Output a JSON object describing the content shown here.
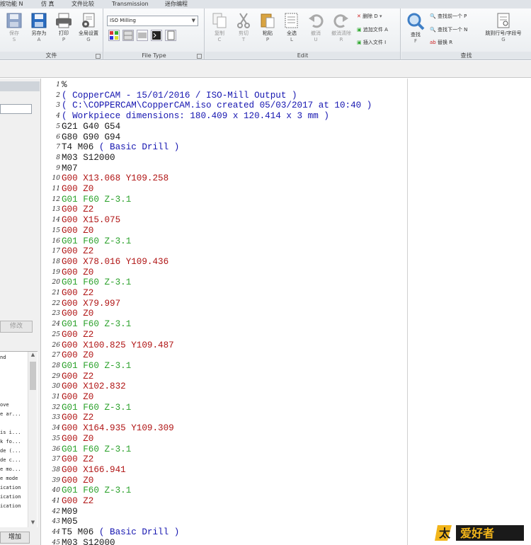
{
  "tabs": [
    "按功能 N",
    "仿 真",
    "文件比较",
    "Transmission",
    "迷你编程"
  ],
  "ribbon": {
    "file": {
      "label": "文件",
      "save": {
        "label": "保存",
        "key": "S"
      },
      "saveas": {
        "label": "另存为",
        "key": "A"
      },
      "print": {
        "label": "打印",
        "key": "P"
      },
      "settings": {
        "label": "全局设置",
        "key": "G"
      }
    },
    "filetype": {
      "label": "File Type",
      "selected": "ISO Milling"
    },
    "edit": {
      "label": "Edit",
      "copy": {
        "label": "复制",
        "key": "C"
      },
      "cut": {
        "label": "剪切",
        "key": "T"
      },
      "paste": {
        "label": "粘贴",
        "key": "P"
      },
      "selectall": {
        "label": "全选",
        "key": "L"
      },
      "undo": {
        "label": "撤消",
        "key": "U"
      },
      "redo": {
        "label": "撤消清除",
        "key": "R"
      },
      "delete": "删除 D",
      "append": "追加文件 A",
      "insert": "插入文件 I"
    },
    "find": {
      "label": "查找",
      "find": {
        "label": "查找",
        "key": "F"
      },
      "find_prev": "查找前一个 P",
      "find_next": "查找下一个 N",
      "replace": "替换 R",
      "goto": {
        "label": "跳到行号/字段号",
        "key": "G"
      }
    }
  },
  "left_panel": {
    "modify_label": "修改",
    "add_label": "增加",
    "list_items": [
      "nd",
      "",
      "",
      "",
      "ove",
      "e ar...",
      "",
      "is i...",
      "k fo...",
      "de (...",
      "de c...",
      "e mo...",
      "e mode",
      "ication",
      "ication",
      "ication"
    ]
  },
  "editor": {
    "lines": [
      {
        "n": "1",
        "parts": [
          {
            "t": "%",
            "c": "k"
          }
        ]
      },
      {
        "n": "2",
        "parts": [
          {
            "t": "( CopperCAM - 15/01/2016 / ISO-Mill Output )",
            "c": "cmt"
          }
        ]
      },
      {
        "n": "3",
        "parts": [
          {
            "t": "( C:\\COPPERCAM\\CopperCAM.iso created 05/03/2017 at 10:40 )",
            "c": "cmt"
          }
        ]
      },
      {
        "n": "4",
        "parts": [
          {
            "t": "( Workpiece dimensions: 180.409 x 120.414 x 3 mm )",
            "c": "cmt"
          }
        ]
      },
      {
        "n": "5",
        "parts": [
          {
            "t": "G21 G40 G54",
            "c": "k"
          }
        ]
      },
      {
        "n": "6",
        "parts": [
          {
            "t": "G80 G90 G94",
            "c": "k"
          }
        ]
      },
      {
        "n": "7",
        "parts": [
          {
            "t": "T4 M06 ",
            "c": "k"
          },
          {
            "t": "( Basic Drill )",
            "c": "cmt"
          }
        ]
      },
      {
        "n": "8",
        "parts": [
          {
            "t": "M03 S12000",
            "c": "k"
          }
        ]
      },
      {
        "n": "9",
        "parts": [
          {
            "t": "M07",
            "c": "k"
          }
        ]
      },
      {
        "n": "10",
        "parts": [
          {
            "t": "G00 X13.068 Y109.258",
            "c": "r"
          }
        ]
      },
      {
        "n": "11",
        "parts": [
          {
            "t": "G00 Z0",
            "c": "r"
          }
        ]
      },
      {
        "n": "12",
        "parts": [
          {
            "t": "G01 F60 Z-3.1",
            "c": "g"
          }
        ]
      },
      {
        "n": "13",
        "parts": [
          {
            "t": "G00 Z2",
            "c": "r"
          }
        ]
      },
      {
        "n": "14",
        "parts": [
          {
            "t": "G00 X15.075",
            "c": "r"
          }
        ]
      },
      {
        "n": "15",
        "parts": [
          {
            "t": "G00 Z0",
            "c": "r"
          }
        ]
      },
      {
        "n": "16",
        "parts": [
          {
            "t": "G01 F60 Z-3.1",
            "c": "g"
          }
        ]
      },
      {
        "n": "17",
        "parts": [
          {
            "t": "G00 Z2",
            "c": "r"
          }
        ]
      },
      {
        "n": "18",
        "parts": [
          {
            "t": "G00 X78.016 Y109.436",
            "c": "r"
          }
        ]
      },
      {
        "n": "19",
        "parts": [
          {
            "t": "G00 Z0",
            "c": "r"
          }
        ]
      },
      {
        "n": "20",
        "parts": [
          {
            "t": "G01 F60 Z-3.1",
            "c": "g"
          }
        ]
      },
      {
        "n": "21",
        "parts": [
          {
            "t": "G00 Z2",
            "c": "r"
          }
        ]
      },
      {
        "n": "22",
        "parts": [
          {
            "t": "G00 X79.997",
            "c": "r"
          }
        ]
      },
      {
        "n": "23",
        "parts": [
          {
            "t": "G00 Z0",
            "c": "r"
          }
        ]
      },
      {
        "n": "24",
        "parts": [
          {
            "t": "G01 F60 Z-3.1",
            "c": "g"
          }
        ]
      },
      {
        "n": "25",
        "parts": [
          {
            "t": "G00 Z2",
            "c": "r"
          }
        ]
      },
      {
        "n": "26",
        "parts": [
          {
            "t": "G00 X100.825 Y109.487",
            "c": "r"
          }
        ]
      },
      {
        "n": "27",
        "parts": [
          {
            "t": "G00 Z0",
            "c": "r"
          }
        ]
      },
      {
        "n": "28",
        "parts": [
          {
            "t": "G01 F60 Z-3.1",
            "c": "g"
          }
        ]
      },
      {
        "n": "29",
        "parts": [
          {
            "t": "G00 Z2",
            "c": "r"
          }
        ]
      },
      {
        "n": "30",
        "parts": [
          {
            "t": "G00 X102.832",
            "c": "r"
          }
        ]
      },
      {
        "n": "31",
        "parts": [
          {
            "t": "G00 Z0",
            "c": "r"
          }
        ]
      },
      {
        "n": "32",
        "parts": [
          {
            "t": "G01 F60 Z-3.1",
            "c": "g"
          }
        ]
      },
      {
        "n": "33",
        "parts": [
          {
            "t": "G00 Z2",
            "c": "r"
          }
        ]
      },
      {
        "n": "34",
        "parts": [
          {
            "t": "G00 X164.935 Y109.309",
            "c": "r"
          }
        ]
      },
      {
        "n": "35",
        "parts": [
          {
            "t": "G00 Z0",
            "c": "r"
          }
        ]
      },
      {
        "n": "36",
        "parts": [
          {
            "t": "G01 F60 Z-3.1",
            "c": "g"
          }
        ]
      },
      {
        "n": "37",
        "parts": [
          {
            "t": "G00 Z2",
            "c": "r"
          }
        ]
      },
      {
        "n": "38",
        "parts": [
          {
            "t": "G00 X166.941",
            "c": "r"
          }
        ]
      },
      {
        "n": "39",
        "parts": [
          {
            "t": "G00 Z0",
            "c": "r"
          }
        ]
      },
      {
        "n": "40",
        "parts": [
          {
            "t": "G01 F60 Z-3.1",
            "c": "g"
          }
        ]
      },
      {
        "n": "41",
        "parts": [
          {
            "t": "G00 Z2",
            "c": "r"
          }
        ]
      },
      {
        "n": "42",
        "parts": [
          {
            "t": "M09",
            "c": "k"
          }
        ]
      },
      {
        "n": "43",
        "parts": [
          {
            "t": "M05",
            "c": "k"
          }
        ]
      },
      {
        "n": "44",
        "parts": [
          {
            "t": "T5 M06 ",
            "c": "k"
          },
          {
            "t": "( Basic Drill )",
            "c": "cmt"
          }
        ]
      },
      {
        "n": "45",
        "parts": [
          {
            "t": "M03 S12000",
            "c": "k"
          }
        ]
      }
    ]
  },
  "watermark": {
    "text": "爱好者",
    "mark": "太"
  },
  "colors": {
    "comment": "#1515b0",
    "rapid": "#b01414",
    "feed": "#2aa12a",
    "keyword": "#1a1a1a"
  }
}
